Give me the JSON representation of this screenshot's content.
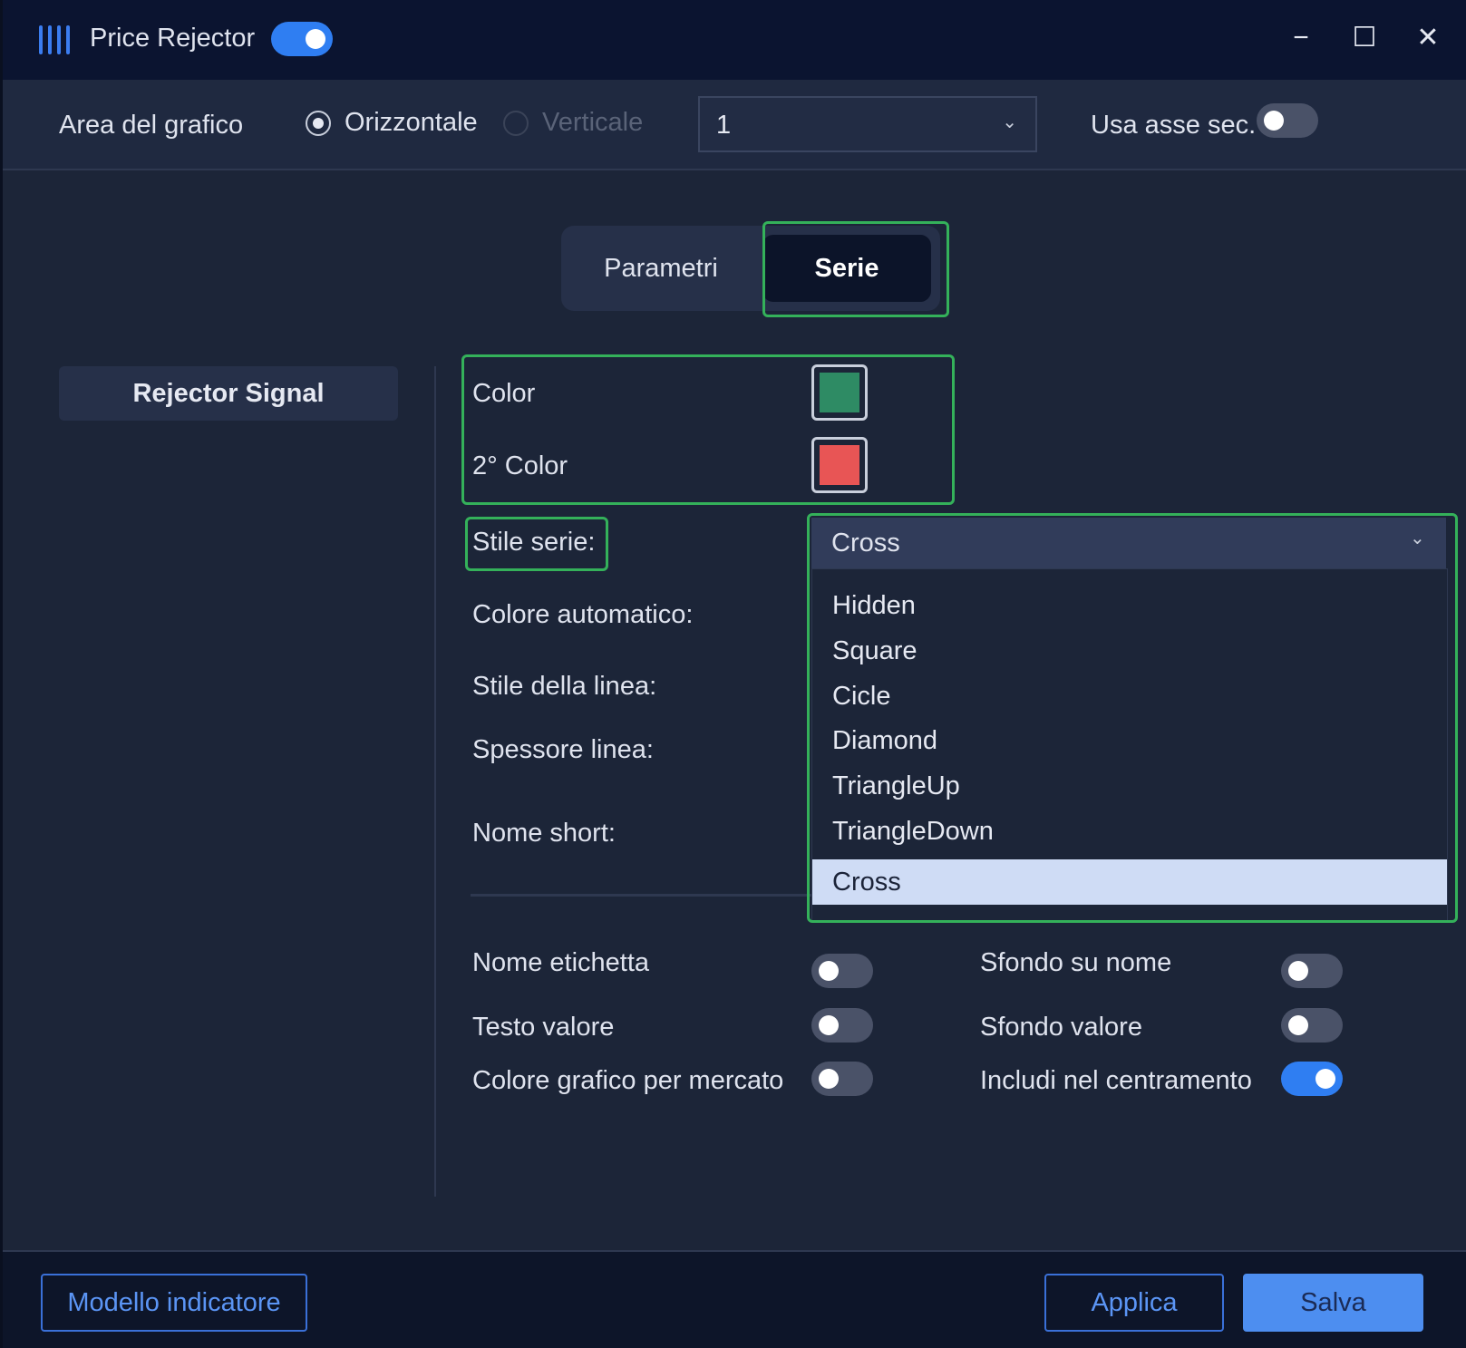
{
  "titlebar": {
    "title": "Price Rejector",
    "enabled": true
  },
  "options": {
    "area_label": "Area del grafico",
    "orientation": {
      "horizontal_label": "Orizzontale",
      "vertical_label": "Verticale",
      "selected": "Orizzontale"
    },
    "area_select_value": "1",
    "secondary_axis_label": "Usa asse sec.",
    "secondary_axis_on": false
  },
  "tabs": [
    {
      "label": "Parametri"
    },
    {
      "label": "Serie",
      "active": true
    }
  ],
  "series_list": [
    {
      "label": "Rejector Signal"
    }
  ],
  "properties": {
    "color_label": "Color",
    "color_value": "#2e8b64",
    "color2_label": "2° Color",
    "color2_value": "#e85555",
    "series_style_label": "Stile serie:",
    "series_style_value": "Cross",
    "auto_color_label": "Colore automatico:",
    "line_style_label": "Stile della linea:",
    "line_width_label": "Spessore linea:",
    "short_name_label": "Nome short:"
  },
  "dropdown": {
    "options": [
      "Hidden",
      "Square",
      "Cicle",
      "Diamond",
      "TriangleUp",
      "TriangleDown",
      "Cross"
    ],
    "selected": "Cross"
  },
  "toggles": [
    {
      "label": "Nome etichetta",
      "on": false
    },
    {
      "label": "Sfondo su nome",
      "on": false
    },
    {
      "label": "Testo valore",
      "on": false
    },
    {
      "label": "Sfondo valore",
      "on": false
    },
    {
      "label": "Colore grafico per mercato",
      "on": false
    },
    {
      "label": "Includi nel centramento",
      "on": true
    }
  ],
  "footer": {
    "template_button": "Modello indicatore",
    "apply_button": "Applica",
    "save_button": "Salva"
  },
  "colors": {
    "accent": "#2f7ef2",
    "highlight": "#34b15a",
    "window_bg": "#1c2538",
    "titlebar_bg": "#0b1430"
  }
}
